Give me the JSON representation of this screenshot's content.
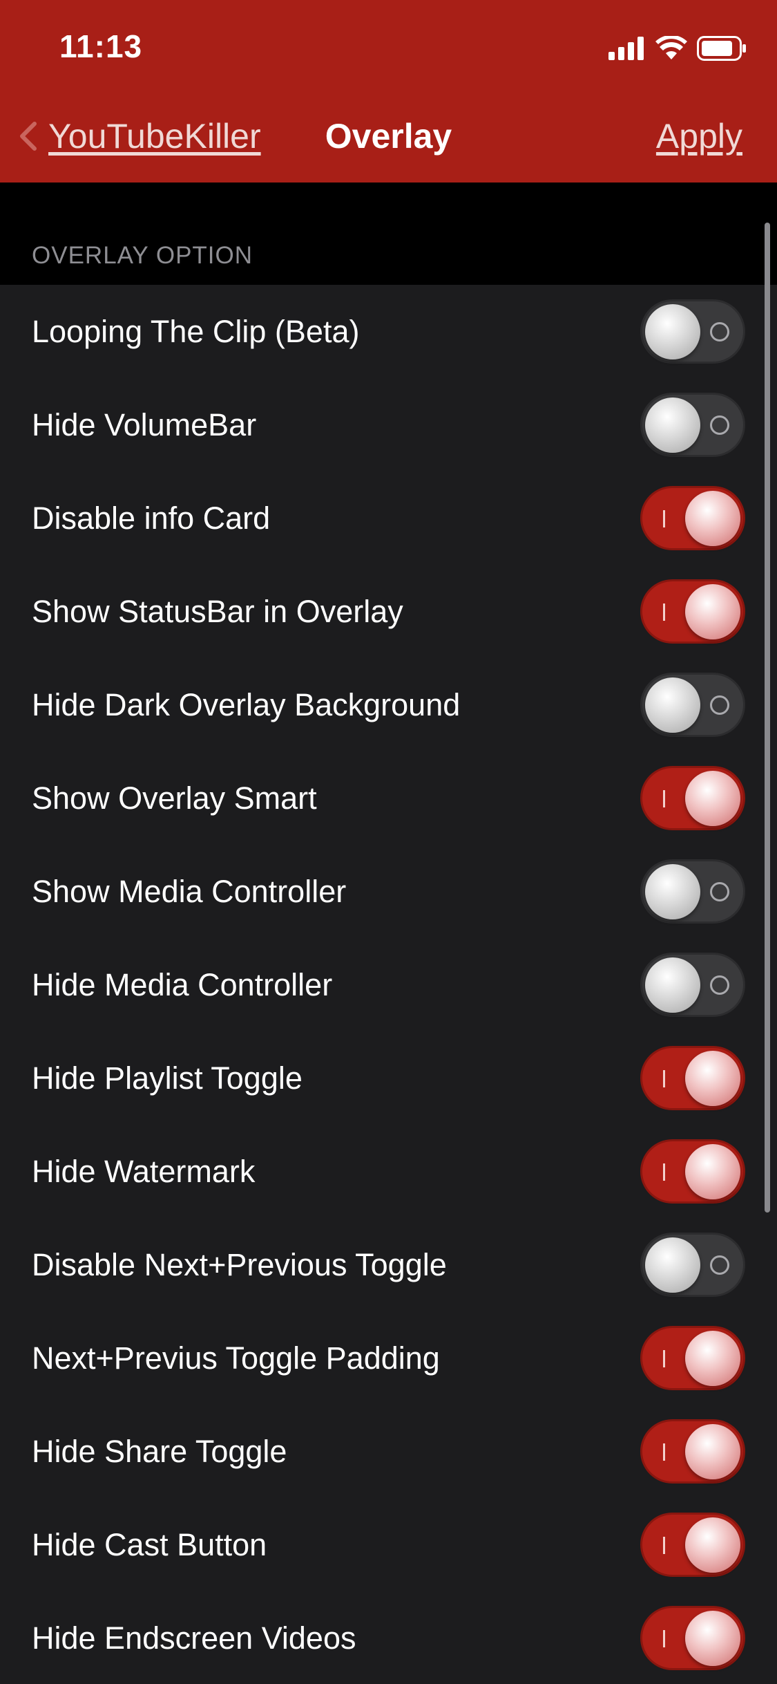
{
  "status_bar": {
    "time": "11:13",
    "icons": [
      "signal-icon",
      "wifi-icon",
      "battery-icon"
    ]
  },
  "nav": {
    "back_label": "YouTubeKiller",
    "title": "Overlay",
    "apply_label": "Apply"
  },
  "section": {
    "title": "OVERLAY OPTION"
  },
  "colors": {
    "accent": "#a81f17",
    "toggle_on": "#b01f17",
    "row_bg": "#1c1c1e",
    "section_text": "#8e8e93"
  },
  "options": [
    {
      "label": "Looping The Clip (Beta)",
      "on": false
    },
    {
      "label": "Hide VolumeBar",
      "on": false
    },
    {
      "label": "Disable info Card",
      "on": true
    },
    {
      "label": "Show StatusBar in Overlay",
      "on": true
    },
    {
      "label": "Hide Dark Overlay Background",
      "on": false
    },
    {
      "label": "Show Overlay Smart",
      "on": true
    },
    {
      "label": "Show Media Controller",
      "on": false
    },
    {
      "label": "Hide Media Controller",
      "on": false
    },
    {
      "label": "Hide Playlist Toggle",
      "on": true
    },
    {
      "label": "Hide Watermark",
      "on": true
    },
    {
      "label": "Disable Next+Previous Toggle",
      "on": false
    },
    {
      "label": "Next+Previus Toggle Padding",
      "on": true
    },
    {
      "label": "Hide Share Toggle",
      "on": true
    },
    {
      "label": "Hide Cast Button",
      "on": true
    },
    {
      "label": "Hide Endscreen Videos",
      "on": true
    }
  ]
}
